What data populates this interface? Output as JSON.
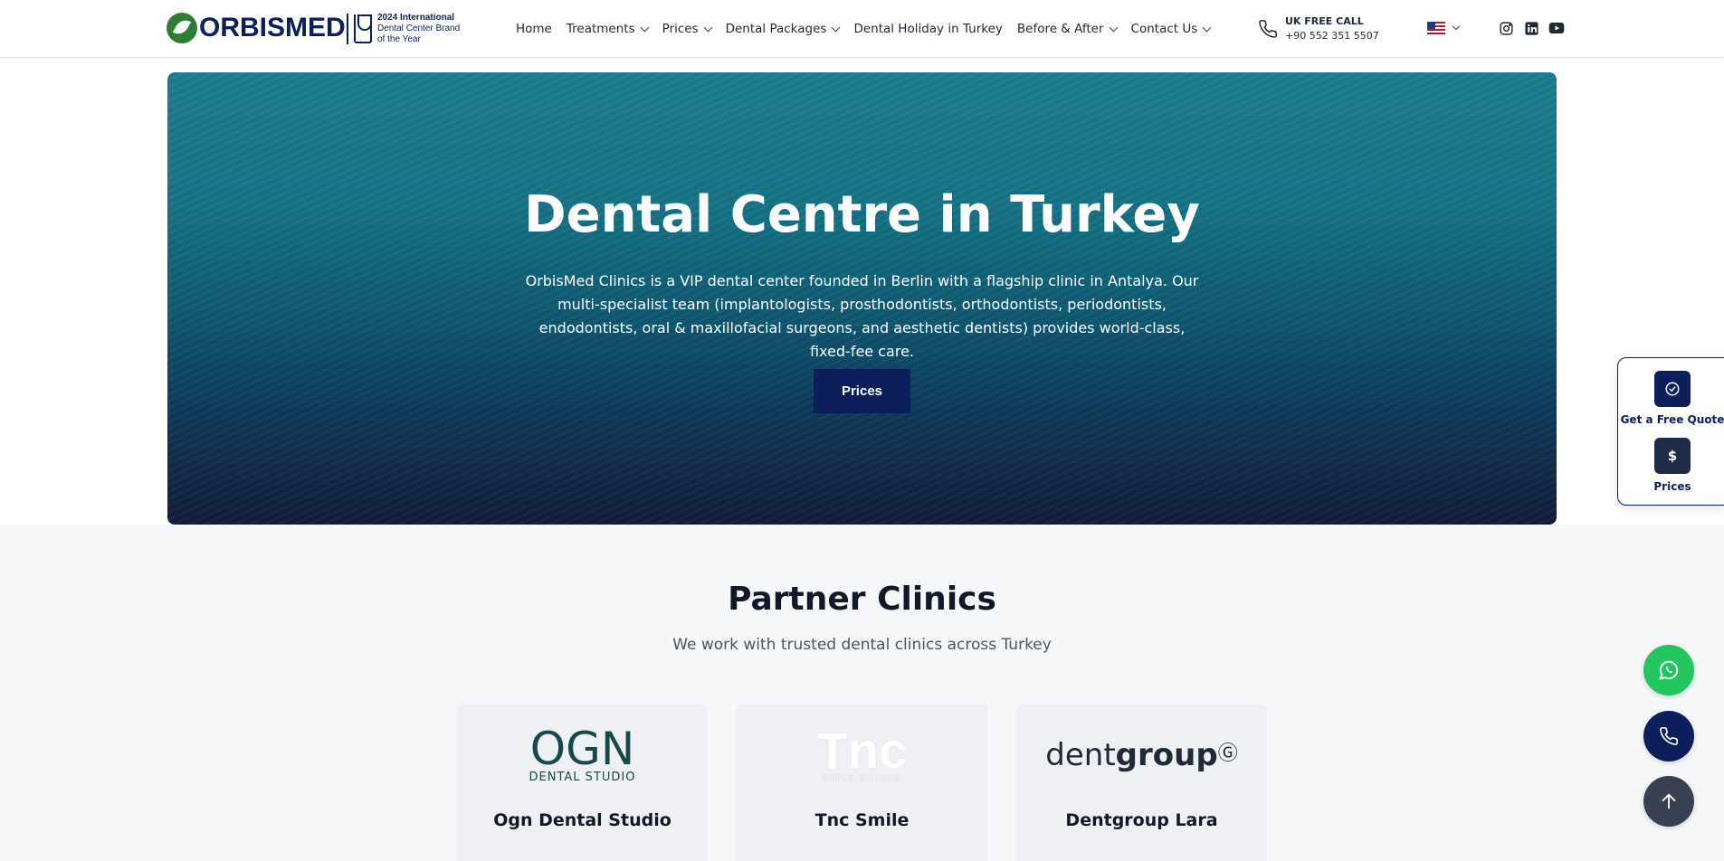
{
  "header": {
    "logo_text": "ORBISMED",
    "award_line1": "2024 International",
    "award_line2": "Dental Center Brand",
    "award_line3": "of the Year",
    "nav": [
      {
        "label": "Home",
        "dropdown": false
      },
      {
        "label": "Treatments",
        "dropdown": true
      },
      {
        "label": "Prices",
        "dropdown": true
      },
      {
        "label": "Dental Packages",
        "dropdown": true
      },
      {
        "label": "Dental Holiday in Turkey",
        "dropdown": false
      },
      {
        "label": "Before & After",
        "dropdown": true
      },
      {
        "label": "Contact Us",
        "dropdown": true
      }
    ],
    "call_label": "UK FREE CALL",
    "call_number": "+90 552 351 5507",
    "language_icon": "us-flag-icon",
    "social_icons": [
      "instagram-icon",
      "linkedin-icon",
      "youtube-icon"
    ]
  },
  "hero": {
    "title": "Dental Centre in Turkey",
    "description": "OrbisMed Clinics is a VIP dental center founded in Berlin with a flagship clinic in Antalya. Our multi-specialist team (implantologists, prosthodontists, orthodontists, periodontists, endodontists, oral & maxillofacial surgeons, and aesthetic dentists) provides world-class, fixed-fee care.",
    "button_label": "Prices"
  },
  "partners": {
    "title": "Partner Clinics",
    "subtitle": "We work with trusted dental clinics across Turkey",
    "clinics": [
      {
        "name": "Ogn Dental Studio",
        "logo_main": "OGN",
        "logo_sub": "DENTAL STUDIO"
      },
      {
        "name": "Tnc Smile",
        "logo_main": "Tnc",
        "logo_sub": "SMILE STUDIO"
      },
      {
        "name": "Dentgroup Lara",
        "logo_main_light": "dent",
        "logo_main_bold": "group"
      }
    ]
  },
  "floating_panel": {
    "quote_label": "Get a Free Quote",
    "prices_label": "Prices",
    "prices_symbol": "$"
  },
  "colors": {
    "brand_navy": "#0c1f5c",
    "whatsapp_green": "#22c55e",
    "scroll_top_gray": "#374151"
  }
}
